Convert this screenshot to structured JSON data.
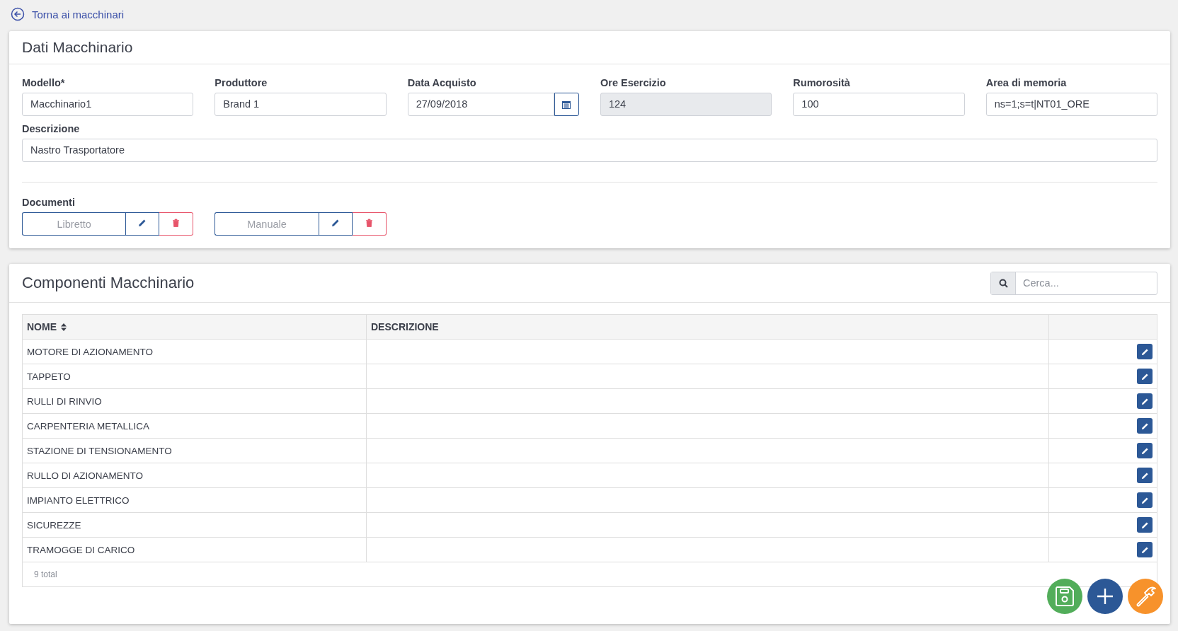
{
  "back_link": {
    "label": "Torna ai macchinari"
  },
  "details": {
    "title": "Dati Macchinario",
    "fields": [
      {
        "label": "Modello*",
        "value": "Macchinario1",
        "kind": "text",
        "disabled": false
      },
      {
        "label": "Produttore",
        "value": "Brand 1",
        "kind": "text",
        "disabled": false
      },
      {
        "label": "Data Acquisto",
        "value": "27/09/2018",
        "kind": "date",
        "disabled": false
      },
      {
        "label": "Ore Esercizio",
        "value": "124",
        "kind": "text",
        "disabled": true
      },
      {
        "label": "Rumorosità",
        "value": "100",
        "kind": "text",
        "disabled": false
      },
      {
        "label": "Area di memoria",
        "value": "ns=1;s=t|NT01_ORE",
        "kind": "text",
        "disabled": false
      }
    ],
    "description": {
      "label": "Descrizione",
      "value": "Nastro Trasportatore"
    },
    "documents": {
      "label": "Documenti",
      "items": [
        {
          "name": "Libretto"
        },
        {
          "name": "Manuale"
        }
      ]
    }
  },
  "components": {
    "title": "Componenti Macchinario",
    "search": {
      "placeholder": "Cerca..."
    },
    "columns": [
      "NOME",
      "DESCRIZIONE"
    ],
    "rows": [
      {
        "name": "MOTORE DI AZIONAMENTO"
      },
      {
        "name": "TAPPETO"
      },
      {
        "name": "RULLI DI RINVIO"
      },
      {
        "name": "CARPENTERIA METALLICA"
      },
      {
        "name": "STAZIONE DI TENSIONAMENTO"
      },
      {
        "name": "RULLO DI AZIONAMENTO"
      },
      {
        "name": "IMPIANTO ELETTRICO"
      },
      {
        "name": "SICUREZZE"
      },
      {
        "name": "TRAMOGGE DI CARICO"
      }
    ],
    "total": "9 total"
  },
  "fab_buttons": [
    {
      "kind": "save"
    },
    {
      "kind": "add"
    },
    {
      "kind": "tools"
    }
  ]
}
